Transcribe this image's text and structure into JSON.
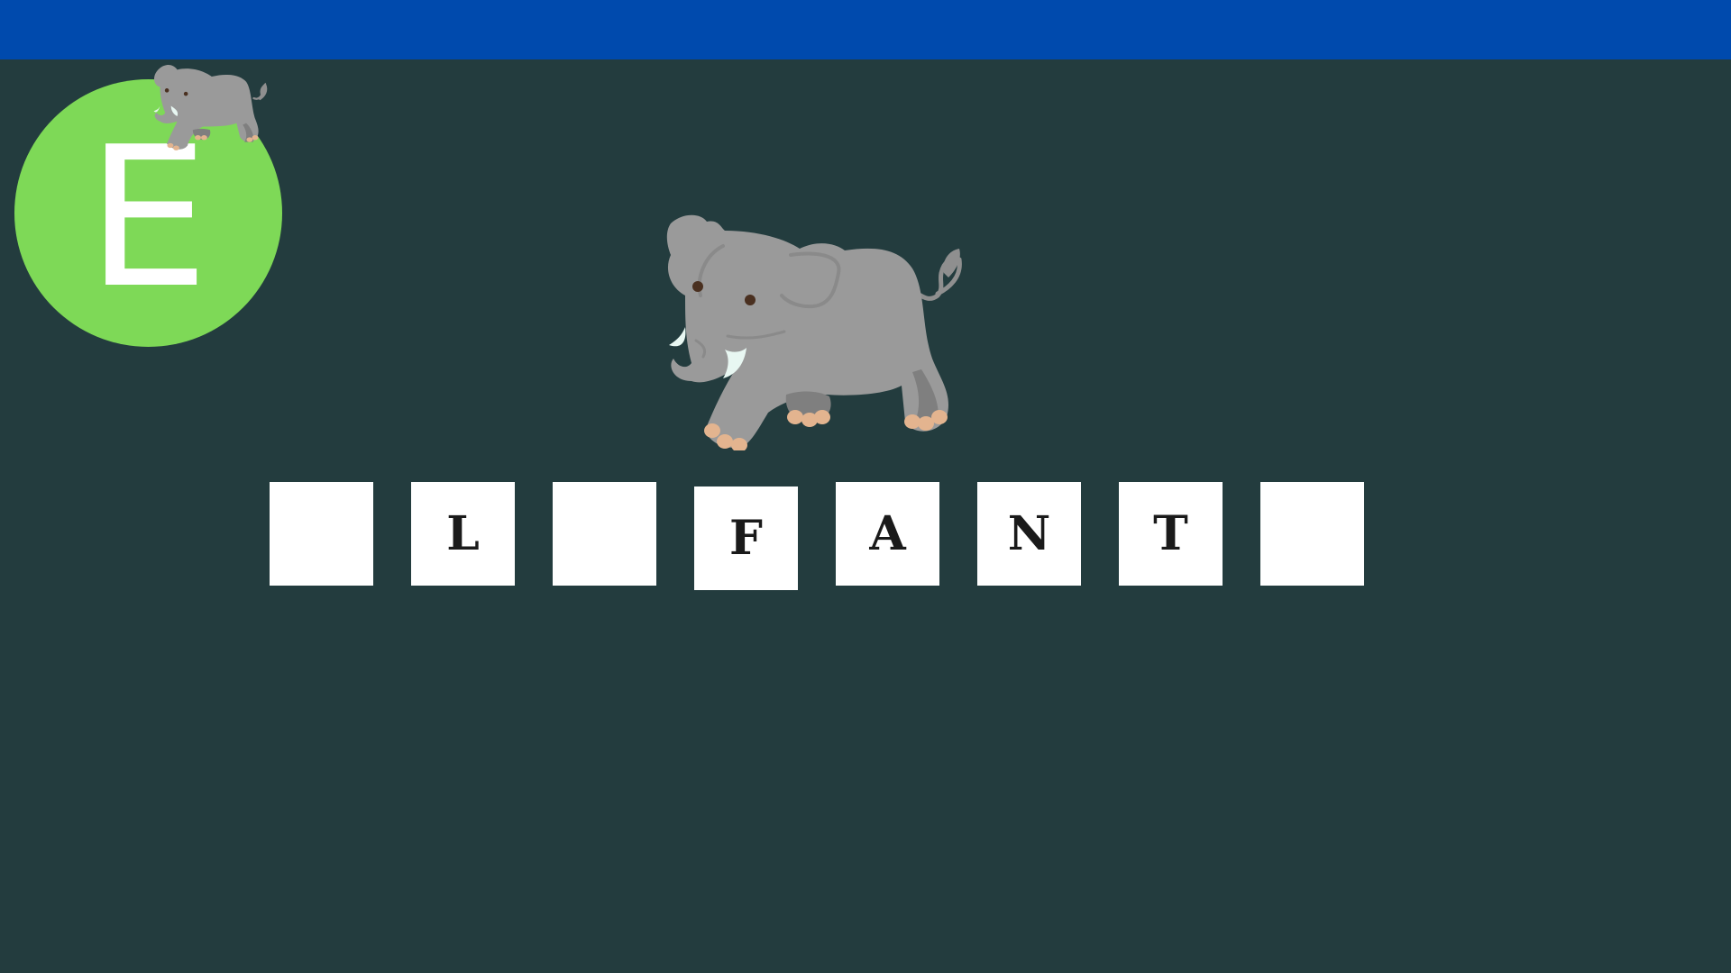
{
  "header": {
    "color": "#004aad"
  },
  "badge": {
    "letter": "E",
    "color": "#7ed957",
    "icon": "elephant-icon"
  },
  "picture": {
    "icon": "elephant-icon"
  },
  "word": {
    "tiles": [
      {
        "letter": "",
        "filled": false
      },
      {
        "letter": "L",
        "filled": true
      },
      {
        "letter": "",
        "filled": false
      },
      {
        "letter": "F",
        "filled": true
      },
      {
        "letter": "A",
        "filled": true
      },
      {
        "letter": "N",
        "filled": true
      },
      {
        "letter": "T",
        "filled": true
      },
      {
        "letter": "",
        "filled": false
      }
    ]
  }
}
